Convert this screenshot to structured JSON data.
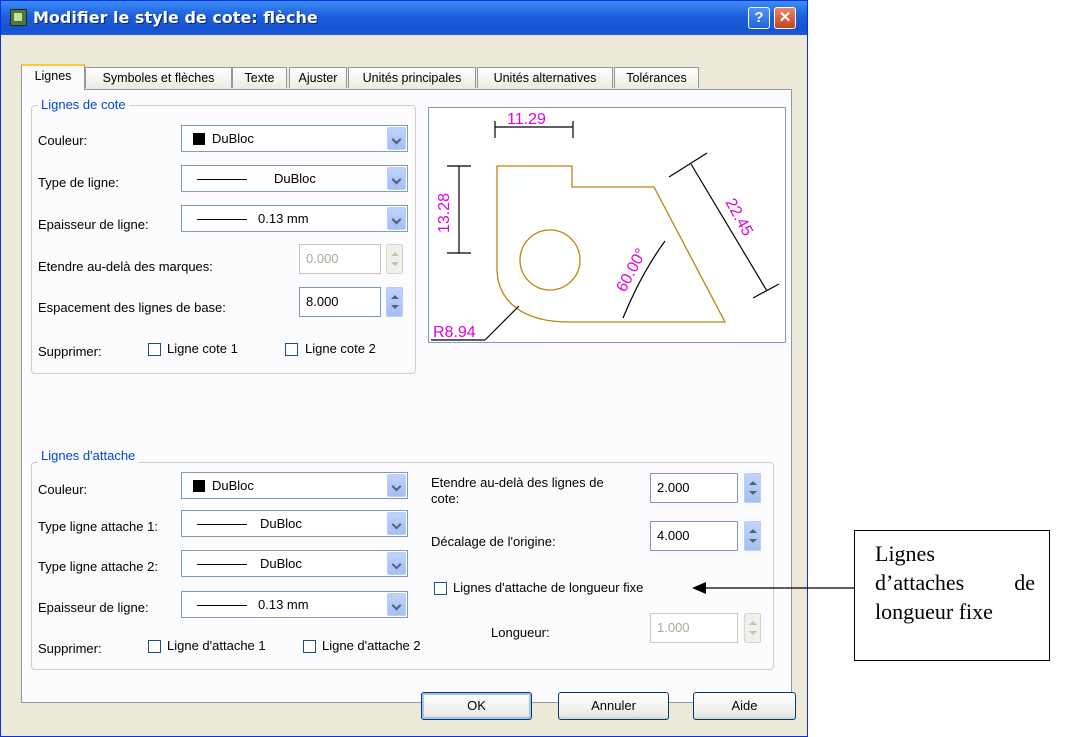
{
  "window": {
    "title": "Modifier le style de cote: flèche",
    "help_glyph": "?",
    "close_glyph": "✕"
  },
  "tabs": [
    {
      "label": "Lignes",
      "active": true
    },
    {
      "label": "Symboles et flèches"
    },
    {
      "label": "Texte"
    },
    {
      "label": "Ajuster"
    },
    {
      "label": "Unités principales"
    },
    {
      "label": "Unités alternatives"
    },
    {
      "label": "Tolérances"
    }
  ],
  "dim_lines": {
    "group_label": "Lignes de cote",
    "color_label": "Couleur:",
    "color_value": "DuBloc",
    "linetype_label": "Type de ligne:",
    "linetype_value": "DuBloc",
    "lineweight_label": "Epaisseur de ligne:",
    "lineweight_value": "0.13 mm",
    "extend_label": "Etendre au-delà des marques:",
    "extend_value": "0.000",
    "baseline_label": "Espacement des lignes de base:",
    "baseline_value": "8.000",
    "suppress_label": "Supprimer:",
    "suppress_1": "Ligne cote 1",
    "suppress_2": "Ligne cote 2"
  },
  "preview": {
    "dim_top": "11.29",
    "dim_left": "13.28",
    "dim_diag": "22.45",
    "dim_angle": "60.00°",
    "dim_radius": "R8.94",
    "color_geom": "#b8860b",
    "color_text": "#e000e0"
  },
  "ext_lines": {
    "group_label": "Lignes d'attache",
    "color_label": "Couleur:",
    "color_value": "DuBloc",
    "type1_label": "Type ligne attache 1:",
    "type1_value": "DuBloc",
    "type2_label": "Type ligne attache 2:",
    "type2_value": "DuBloc",
    "lineweight_label": "Epaisseur de ligne:",
    "lineweight_value": "0.13 mm",
    "suppress_label": "Supprimer:",
    "suppress_1": "Ligne d'attache 1",
    "suppress_2": "Ligne d'attache 2",
    "extend_label_1": "Etendre au-delà des lignes de",
    "extend_label_2": "cote:",
    "extend_value": "2.000",
    "offset_label": "Décalage de l'origine:",
    "offset_value": "4.000",
    "fixed_label": "Lignes d'attache de longueur fixe",
    "length_label": "Longueur:",
    "length_value": "1.000"
  },
  "buttons": {
    "ok": "OK",
    "cancel": "Annuler",
    "help": "Aide"
  },
  "annotation": {
    "line1": "Lignes",
    "line2a": "d’attaches",
    "line2b": "de",
    "line3": "longueur fixe"
  }
}
